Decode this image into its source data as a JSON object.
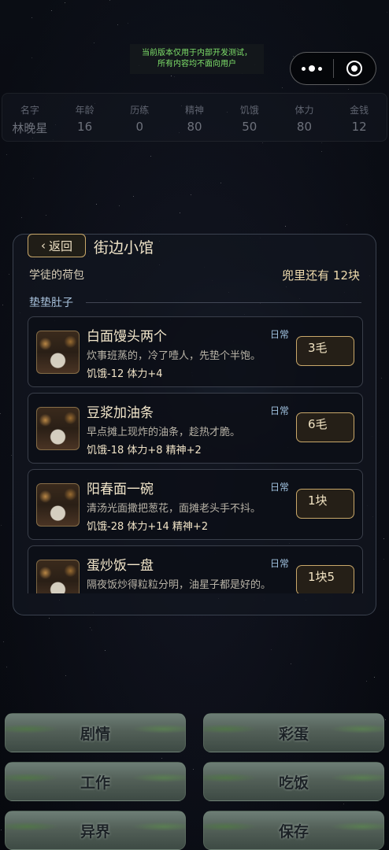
{
  "dev_notice": {
    "line1": "当前版本仅用于内部开发测试，",
    "line2": "所有内容均不面向用户"
  },
  "stats": [
    {
      "label": "名字",
      "value": "林晚星"
    },
    {
      "label": "年龄",
      "value": "16"
    },
    {
      "label": "历练",
      "value": "0"
    },
    {
      "label": "精神",
      "value": "80"
    },
    {
      "label": "饥饿",
      "value": "50"
    },
    {
      "label": "体力",
      "value": "80"
    },
    {
      "label": "金钱",
      "value": "12"
    }
  ],
  "panel": {
    "back_label": "返回",
    "back_icon": "chevron-left-icon",
    "title": "街边小馆",
    "bag_label": "学徒的荷包",
    "money_text": "兜里还有 12块",
    "section_title": "垫垫肚子"
  },
  "items": [
    {
      "name": "白面馒头两个",
      "tag": "日常",
      "desc": "炊事班蒸的，冷了噎人，先垫个半饱。",
      "effect": "饥饿-12  体力+4",
      "price": "3毛"
    },
    {
      "name": "豆浆加油条",
      "tag": "日常",
      "desc": "早点摊上现炸的油条，趁热才脆。",
      "effect": "饥饿-18  体力+8  精神+2",
      "price": "6毛"
    },
    {
      "name": "阳春面一碗",
      "tag": "日常",
      "desc": "清汤光面撒把葱花，面摊老头手不抖。",
      "effect": "饥饿-28  体力+14  精神+2",
      "price": "1块"
    },
    {
      "name": "蛋炒饭一盘",
      "tag": "日常",
      "desc": "隔夜饭炒得粒粒分明，油星子都是好的。",
      "effect": "",
      "price": "1块5"
    }
  ],
  "actions": {
    "story": "剧情",
    "easter_egg": "彩蛋",
    "work": "工作",
    "eat": "吃饭",
    "otherworld": "异界",
    "save": "保存"
  }
}
